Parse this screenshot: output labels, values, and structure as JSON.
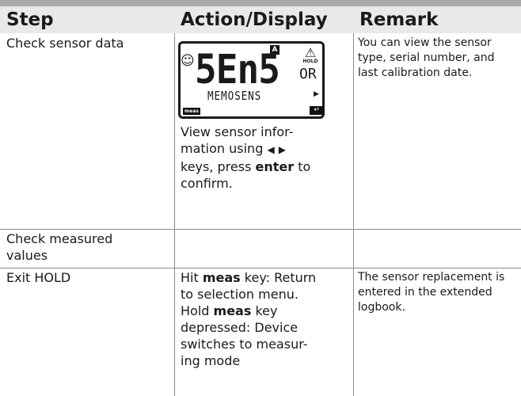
{
  "header": {
    "step": "Step",
    "action": "Action/Display",
    "remark": "Remark"
  },
  "rows": [
    {
      "step": "Check sensor data",
      "display": {
        "big_text": "5En5",
        "sup_text": "OR",
        "sub_text": "MEMOSENS",
        "badge": "A",
        "hold_label": "HOLD",
        "meas_label": "meas",
        "icons": [
          "smiley-icon",
          "warning-hold-icon",
          "right-arrow-icon",
          "enter-key-icon"
        ]
      },
      "action_lines": [
        "View sensor infor-",
        "mation using ",
        " keys, press ",
        "enter",
        " to",
        "confirm."
      ],
      "remark": [
        "You can view the sensor",
        "type, serial number, and",
        "last calibration date."
      ]
    },
    {
      "step": [
        "Check measured",
        "values"
      ],
      "action": "",
      "remark": ""
    },
    {
      "step": "Exit HOLD",
      "action": {
        "l1a": "Hit ",
        "l1b": "meas",
        "l1c": " key: Return",
        "l2": "to selection menu.",
        "l3a": "Hold ",
        "l3b": "meas",
        "l3c": " key",
        "l4": "depressed: Device",
        "l5": "switches to measur-",
        "l6": "ing mode"
      },
      "remark": [
        "The sensor replacement is",
        "entered in the extended",
        "logbook."
      ]
    }
  ]
}
